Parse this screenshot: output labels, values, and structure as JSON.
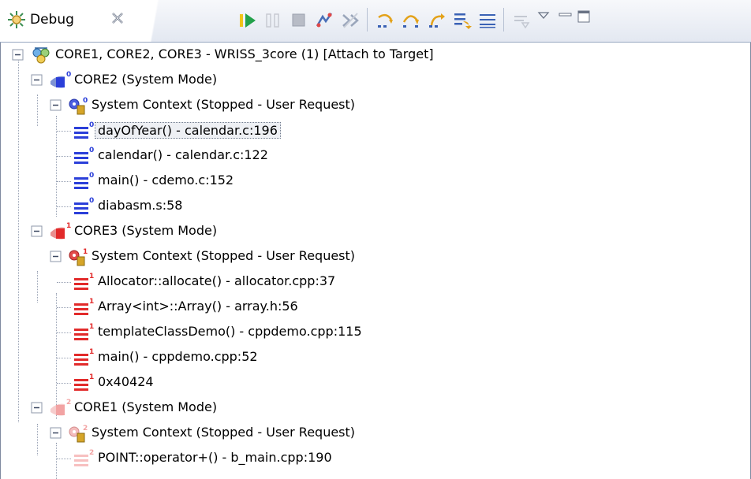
{
  "tab": {
    "title": "Debug"
  },
  "toolbar": {
    "buttons": [
      {
        "name": "resume-button",
        "icon": "resume-icon",
        "enabled": true
      },
      {
        "name": "suspend-button",
        "icon": "suspend-icon",
        "enabled": false
      },
      {
        "name": "terminate-button",
        "icon": "terminate-icon",
        "enabled": false
      },
      {
        "name": "connect-button",
        "icon": "connect-icon",
        "enabled": true
      },
      {
        "name": "disconnect-button",
        "icon": "disconnect-icon",
        "enabled": true
      },
      {
        "name": "step-into-button",
        "icon": "step-into-icon",
        "enabled": true
      },
      {
        "name": "step-over-button",
        "icon": "step-over-icon",
        "enabled": true
      },
      {
        "name": "step-return-button",
        "icon": "step-return-icon",
        "enabled": true
      },
      {
        "name": "drop-to-frame-button",
        "icon": "drop-to-frame-icon",
        "enabled": true
      },
      {
        "name": "instruction-step-button",
        "icon": "instruction-step-icon",
        "enabled": true
      },
      {
        "name": "use-step-filters-button",
        "icon": "step-filters-icon",
        "enabled": false
      },
      {
        "name": "view-menu-button",
        "icon": "triangle-down-icon",
        "enabled": true
      },
      {
        "name": "minimize-button",
        "icon": "minimize-icon",
        "enabled": true
      },
      {
        "name": "maximize-button",
        "icon": "maximize-icon",
        "enabled": true
      }
    ]
  },
  "tree": {
    "root": "CORE1, CORE2, CORE3 - WRISS_3core (1) [Attach to Target]",
    "cores": [
      {
        "label": "CORE2 (System Mode)",
        "badge": "0",
        "color": "#2b3fd9",
        "context": "System Context (Stopped - User Request)",
        "frames": [
          "dayOfYear() - calendar.c:196",
          "calendar() - calendar.c:122",
          "main() - cdemo.c:152",
          "diabasm.s:58"
        ],
        "selected_frame": 0
      },
      {
        "label": "CORE3 (System Mode)",
        "badge": "1",
        "color": "#e22a2a",
        "context": "System Context (Stopped - User Request)",
        "frames": [
          "Allocator::allocate() - allocator.cpp:37",
          "Array<int>::Array() - array.h:56",
          "templateClassDemo() - cppdemo.cpp:115",
          "main() - cppdemo.cpp:52",
          "0x40424"
        ],
        "selected_frame": -1
      },
      {
        "label": "CORE1 (System Mode)",
        "badge": "2",
        "color": "#f2a3a3",
        "context": "System Context (Stopped - User Request)",
        "frames": [
          "POINT::operator+() - b_main.cpp:190"
        ],
        "selected_frame": -1
      }
    ]
  }
}
